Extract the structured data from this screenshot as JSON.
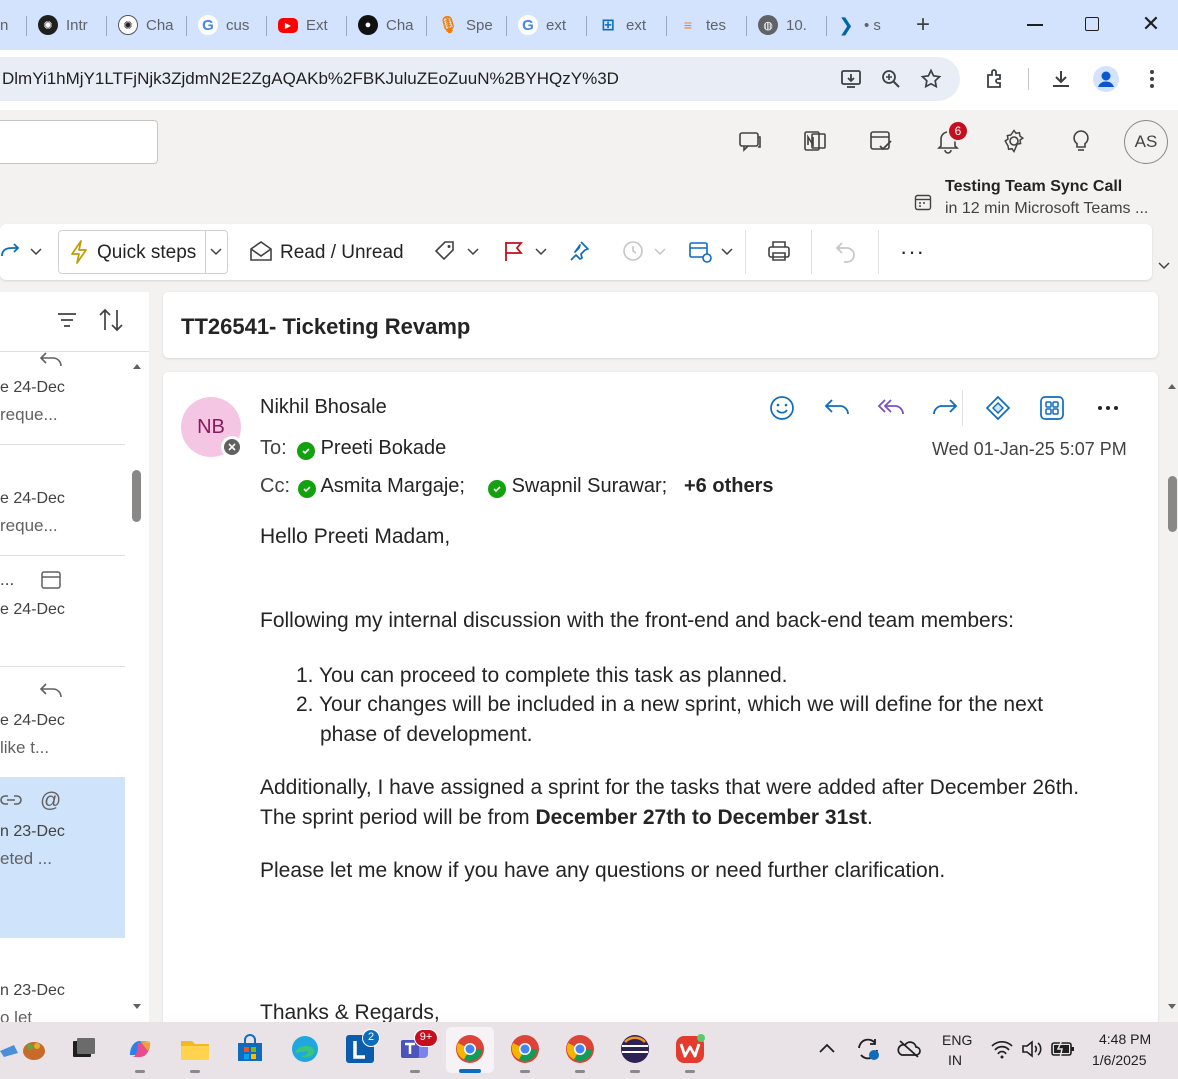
{
  "browser": {
    "tabs": [
      {
        "label": "n",
        "icon": "generic-tab-icon"
      },
      {
        "label": "Intr",
        "icon": "chatgpt-icon"
      },
      {
        "label": "Cha",
        "icon": "chatgpt-icon"
      },
      {
        "label": "cus",
        "icon": "google-icon"
      },
      {
        "label": "Ext",
        "icon": "youtube-icon"
      },
      {
        "label": "Cha",
        "icon": "chatbot-icon"
      },
      {
        "label": "Spe",
        "icon": "microphone-icon"
      },
      {
        "label": "ext",
        "icon": "google-icon"
      },
      {
        "label": "ext",
        "icon": "grid-icon"
      },
      {
        "label": "tes",
        "icon": "stackoverflow-icon"
      },
      {
        "label": "10.",
        "icon": "globe-icon"
      },
      {
        "label": "• s",
        "icon": "vscode-icon"
      }
    ],
    "new_tab": "+",
    "url": "DlmYi1hMjY1LTFjNjk3ZjdmN2E2ZgAQAKb%2FBKJuluZEoZuuN%2BYHQzY%3D"
  },
  "header": {
    "notification_count": "6",
    "avatar_initials": "AS",
    "reminder_title": "Testing Team Sync Call",
    "reminder_sub": "in 12 min Microsoft Teams ..."
  },
  "ribbon": {
    "quick_steps": "Quick steps",
    "read_unread": "Read / Unread",
    "more": "···"
  },
  "message_list": {
    "items": [
      {
        "date": "e 24-Dec",
        "preview": "reque..."
      },
      {
        "date": "e 24-Dec",
        "preview": "reque..."
      },
      {
        "date": "e 24-Dec",
        "preview": "",
        "sender": "..."
      },
      {
        "date": "e 24-Dec",
        "preview": "like t..."
      },
      {
        "date": "n 23-Dec",
        "preview": "eted ..."
      },
      {
        "date": "n 23-Dec",
        "preview": "o let"
      }
    ]
  },
  "email": {
    "subject": "TT26541- Ticketing Revamp",
    "sender": "Nikhil Bhosale",
    "sender_initials": "NB",
    "to_label": "To:",
    "to": "Preeti Bokade",
    "cc_label": "Cc:",
    "cc": [
      "Asmita Margaje;",
      "Swapnil Surawar;"
    ],
    "cc_more": "+6 others",
    "timestamp": "Wed 01-Jan-25 5:07 PM",
    "greeting": "Hello Preeti Madam,",
    "intro": "Following my internal discussion with the front-end and back-end team members:",
    "list": [
      "You can proceed to complete this task as planned.",
      "Your changes will be included in a new sprint, which we will define for the next phase of development."
    ],
    "para2_a": "Additionally, I have assigned a sprint for the tasks that were added after December 26th. The sprint period will be from ",
    "para2_bold": "December 27th to December 31st",
    "para2_end": ".",
    "para3": "Please let me know if you have any questions or need further clarification.",
    "signoff": "Thanks & Regards,"
  },
  "taskbar": {
    "language": "ENG",
    "region": "IN",
    "time": "4:48 PM",
    "date": "1/6/2025",
    "teams_badge": "9+",
    "l_badge": "2"
  },
  "colors": {
    "tabstrip": "#d3e3fd",
    "accent": "#0f6cbd",
    "avatar_nb": "#f4c6e3",
    "selected_item": "#cfe4fa",
    "presence_green": "#13a10e",
    "badge_red": "#c50f1f"
  }
}
